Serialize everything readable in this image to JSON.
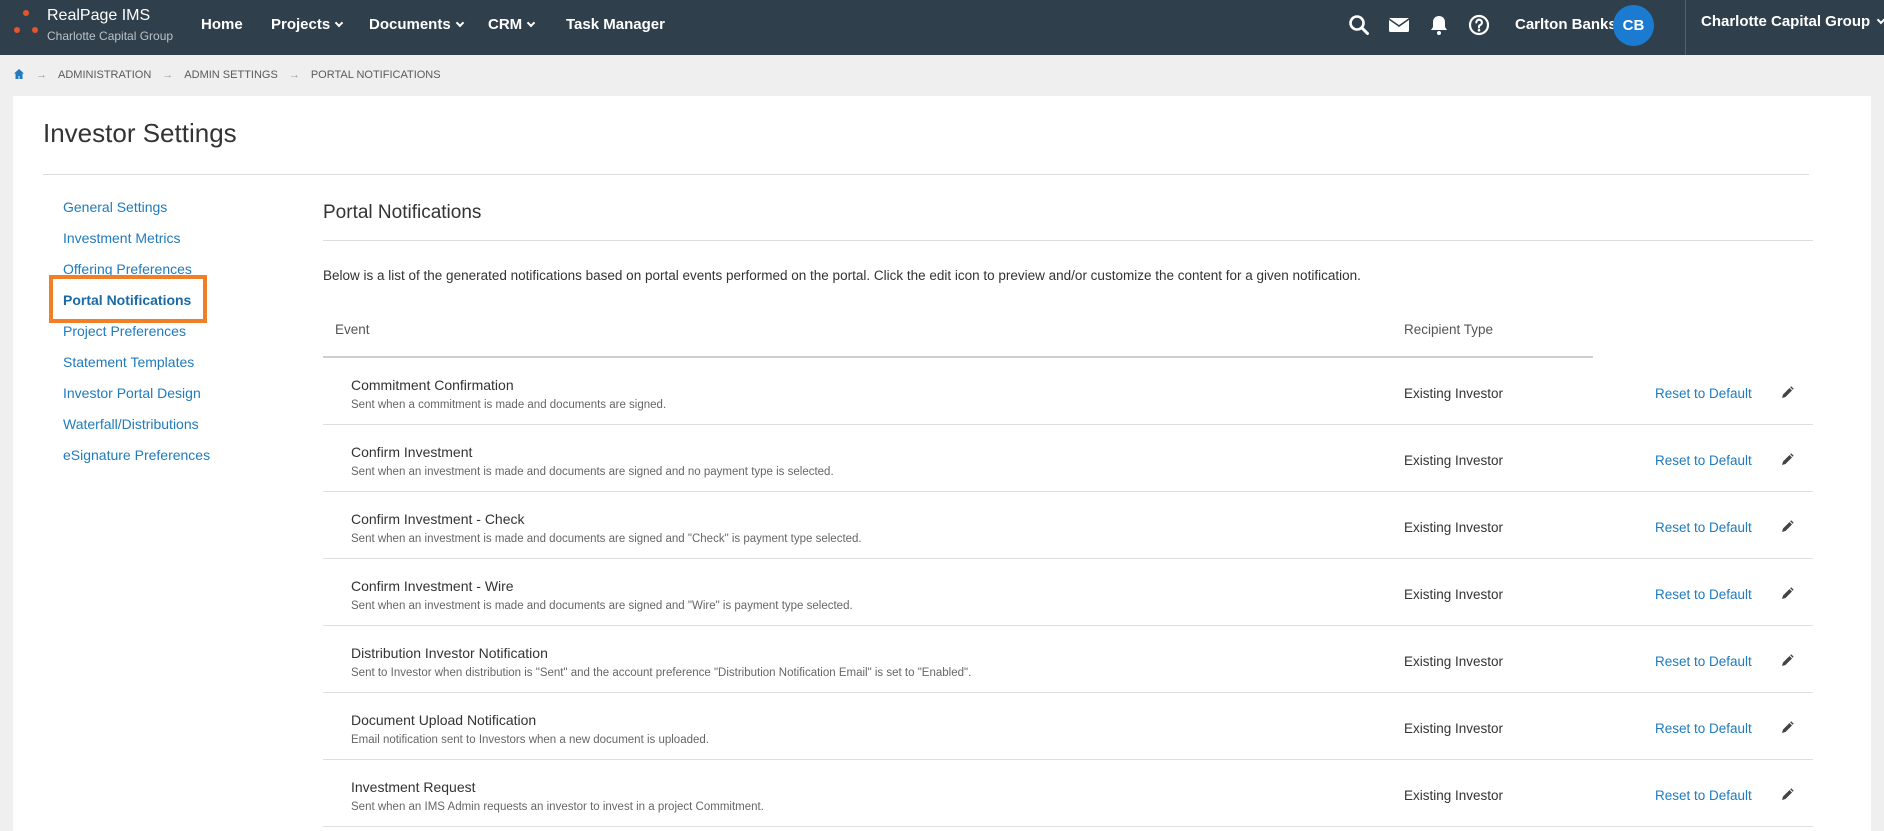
{
  "header": {
    "brand_title": "RealPage IMS",
    "brand_subtitle": "Charlotte Capital Group",
    "nav": [
      {
        "label": "Home"
      },
      {
        "label": "Projects"
      },
      {
        "label": "Documents"
      },
      {
        "label": "CRM"
      },
      {
        "label": "Task Manager"
      }
    ],
    "icons": [
      "search-icon",
      "mail-icon",
      "bell-icon",
      "help-icon"
    ],
    "user_name": "Carlton Banks",
    "user_initials": "CB",
    "org_name": "Charlotte Capital Group"
  },
  "breadcrumb": [
    "ADMINISTRATION",
    "ADMIN SETTINGS",
    "PORTAL NOTIFICATIONS"
  ],
  "page_title": "Investor Settings",
  "sidebar": {
    "items": [
      {
        "label": "General Settings"
      },
      {
        "label": "Investment Metrics"
      },
      {
        "label": "Offering Preferences"
      },
      {
        "label": "Portal Notifications"
      },
      {
        "label": "Project Preferences"
      },
      {
        "label": "Statement Templates"
      },
      {
        "label": "Investor Portal Design"
      },
      {
        "label": "Waterfall/Distributions"
      },
      {
        "label": "eSignature Preferences"
      }
    ],
    "active": "Portal Notifications"
  },
  "main": {
    "section_title": "Portal Notifications",
    "intro": "Below is a list of the generated notifications based on portal events performed on the portal. Click the edit icon to preview and/or customize the content for a given notification.",
    "columns": {
      "event": "Event",
      "recipient": "Recipient Type"
    },
    "rows": [
      {
        "title": "Commitment Confirmation",
        "desc": "Sent when a commitment is made and documents are signed.",
        "recipient": "Existing Investor",
        "action": "Reset to Default"
      },
      {
        "title": "Confirm Investment",
        "desc": "Sent when an investment is made and documents are signed and no payment type is selected.",
        "recipient": "Existing Investor",
        "action": "Reset to Default"
      },
      {
        "title": "Confirm Investment - Check",
        "desc": "Sent when an investment is made and documents are signed and \"Check\" is payment type selected.",
        "recipient": "Existing Investor",
        "action": "Reset to Default"
      },
      {
        "title": "Confirm Investment - Wire",
        "desc": "Sent when an investment is made and documents are signed and \"Wire\" is payment type selected.",
        "recipient": "Existing Investor",
        "action": "Reset to Default"
      },
      {
        "title": "Distribution Investor Notification",
        "desc": "Sent to Investor when distribution is \"Sent\" and the account preference \"Distribution Notification Email\" is set to \"Enabled\".",
        "recipient": "Existing Investor",
        "action": "Reset to Default"
      },
      {
        "title": "Document Upload Notification",
        "desc": "Email notification sent to Investors when a new document is uploaded.",
        "recipient": "Existing Investor",
        "action": "Reset to Default"
      },
      {
        "title": "Investment Request",
        "desc": "Sent when an IMS Admin requests an investor to invest in a project Commitment.",
        "recipient": "Existing Investor",
        "action": "Reset to Default"
      }
    ]
  },
  "colors": {
    "topbar": "#2f3f4b",
    "link": "#1f7bbd",
    "highlight": "#f07f27",
    "avatar": "#1a7bd0",
    "logo": "#e8542e"
  }
}
